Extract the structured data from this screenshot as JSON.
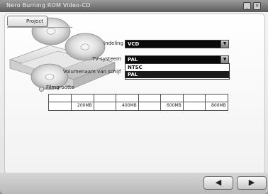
{
  "window": {
    "title": "Nero Burning ROM Video-CD"
  },
  "tabs": [
    {
      "label": "Project"
    }
  ],
  "form": {
    "indeling": {
      "label": "Indeling",
      "value": "VCD"
    },
    "tv_systeem": {
      "label": "TV-systeem",
      "value": "PAL",
      "options": [
        "NTSC",
        "PAL"
      ]
    },
    "volumenaam": {
      "label": "Volumenaam van schijf"
    },
    "filmgrootte": {
      "label": "Filmgrootte"
    }
  },
  "size_scale": {
    "labels": [
      "200MB",
      "400MB",
      "600MB",
      "800MB"
    ]
  },
  "nav": {
    "back": "◀",
    "next": "▶"
  }
}
